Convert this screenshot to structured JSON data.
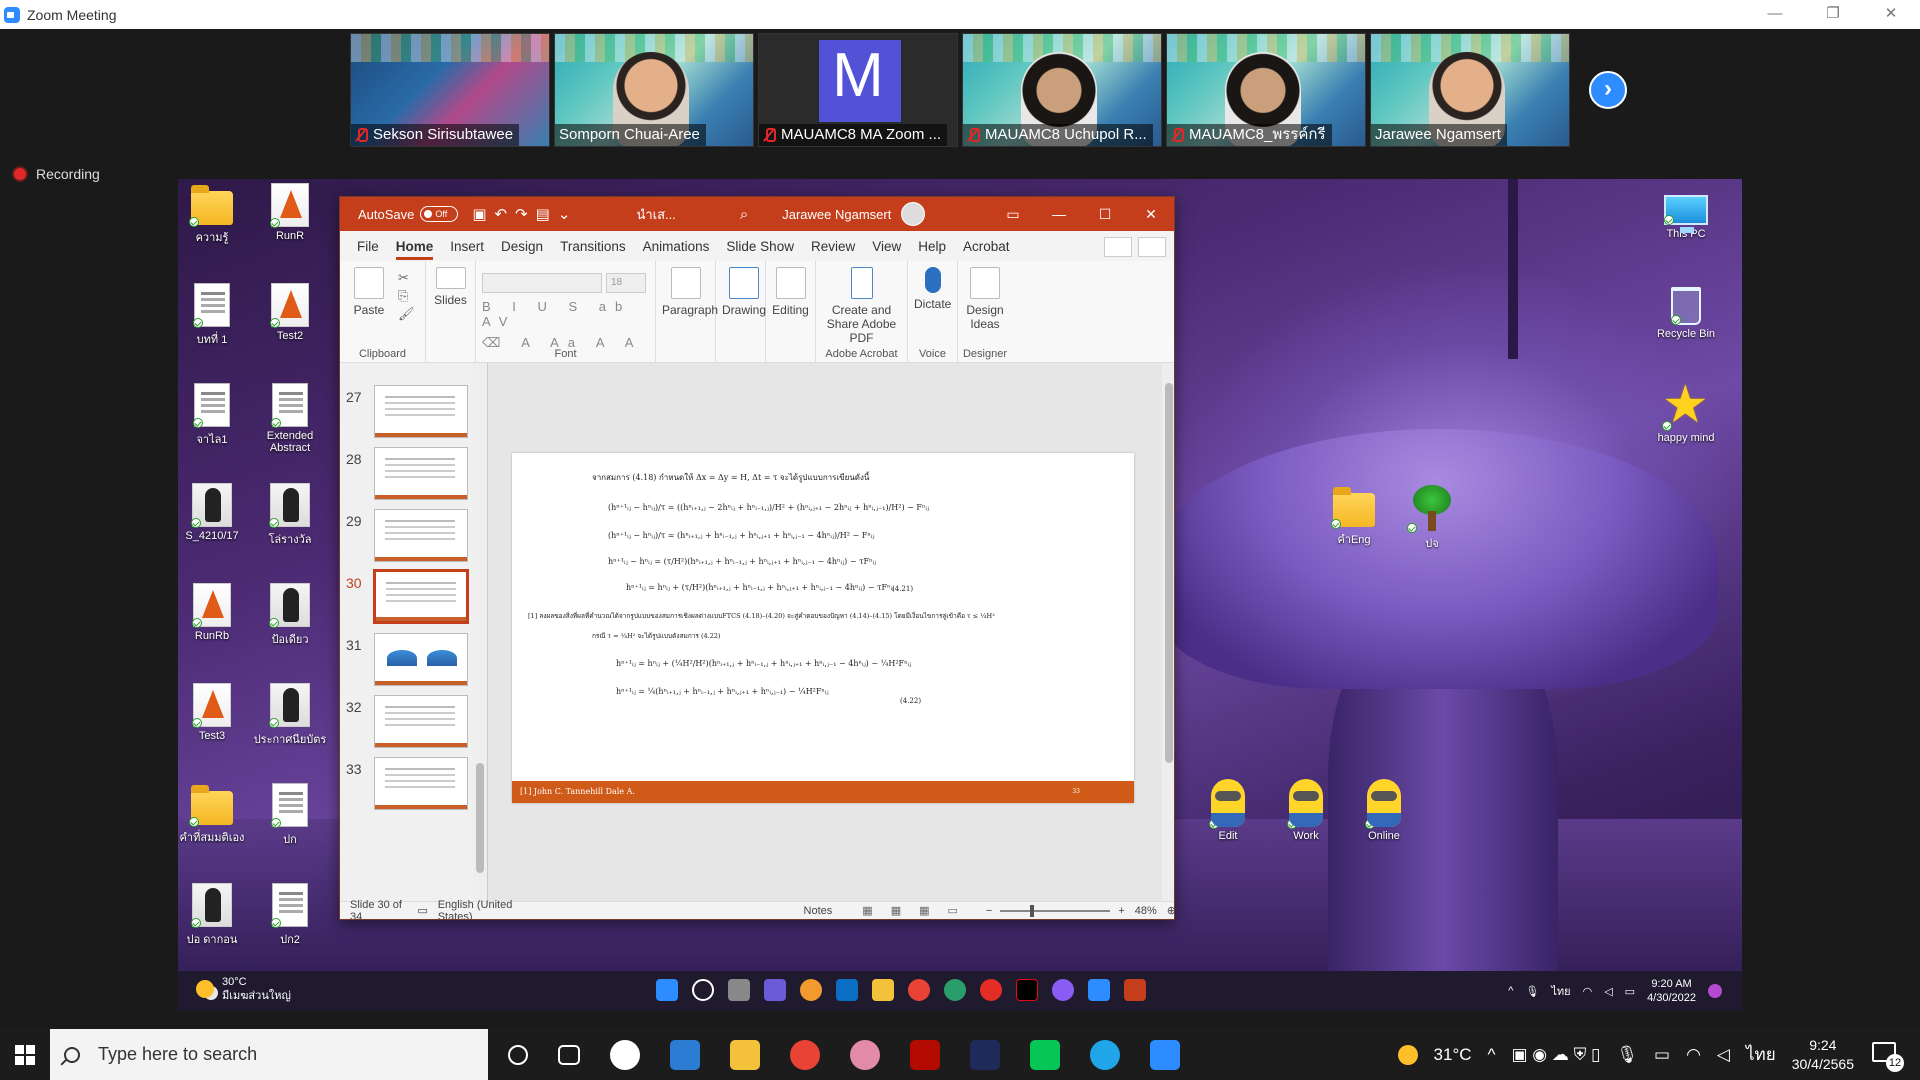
{
  "zoom": {
    "window_title": "Zoom Meeting",
    "window_controls": [
      "—",
      "❐",
      "✕"
    ],
    "participants": [
      {
        "name": "Sekson Sirisubtawee",
        "muted": true,
        "video": "screen"
      },
      {
        "name": "Somporn Chuai-Aree",
        "muted": false,
        "video": "camera"
      },
      {
        "name": "MAUAMC8 MA Zoom ...",
        "muted": true,
        "video": "avatar",
        "initial": "M"
      },
      {
        "name": "MAUAMC8 Uchupol R...",
        "muted": true,
        "video": "camera"
      },
      {
        "name": "MAUAMC8_พรรค์กรี",
        "muted": true,
        "video": "camera"
      },
      {
        "name": "Jarawee Ngamsert",
        "muted": false,
        "video": "camera"
      }
    ],
    "next_page": "›",
    "recording_label": "Recording"
  },
  "desktop": {
    "left_icons": [
      {
        "label": "ความรู้",
        "type": "folder"
      },
      {
        "label": "RunR",
        "type": "rlogo"
      },
      {
        "label": "บทที่ 1",
        "type": "doc"
      },
      {
        "label": "Test2",
        "type": "rlogo"
      },
      {
        "label": "จาไล1",
        "type": "doc"
      },
      {
        "label": "Extended Abstract",
        "type": "doc"
      },
      {
        "label": "S_4210/17",
        "type": "photo"
      },
      {
        "label": "โล่รางวัล",
        "type": "photo"
      },
      {
        "label": "RunRb",
        "type": "rlogo"
      },
      {
        "label": "ป้อเดียว",
        "type": "photo"
      },
      {
        "label": "Test3",
        "type": "rlogo"
      },
      {
        "label": "ประกาศนียบัตร",
        "type": "photo"
      },
      {
        "label": "คำที่สมมติเอง",
        "type": "folder"
      },
      {
        "label": "ปก",
        "type": "doc"
      },
      {
        "label": "ปอ ดากอน",
        "type": "photo"
      },
      {
        "label": "ปก2",
        "type": "doc"
      }
    ],
    "right_icons": [
      {
        "label": "This PC",
        "type": "pc"
      },
      {
        "label": "Recycle Bin",
        "type": "bin"
      },
      {
        "label": "happy mind",
        "type": "star"
      },
      {
        "label": "คำEng",
        "type": "folder"
      },
      {
        "label": "ปจ",
        "type": "tree"
      },
      {
        "label": "Edit",
        "type": "minion"
      },
      {
        "label": "Work",
        "type": "minion"
      },
      {
        "label": "Online",
        "type": "minion"
      }
    ]
  },
  "ppt": {
    "autosave_label": "AutoSave",
    "autosave_state": "Off",
    "doc_name": "นำเส...",
    "user_name": "Jarawee Ngamsert",
    "tabs": [
      "File",
      "Home",
      "Insert",
      "Design",
      "Transitions",
      "Animations",
      "Slide Show",
      "Review",
      "View",
      "Help",
      "Acrobat"
    ],
    "active_tab": "Home",
    "ribbon": {
      "paste": "Paste",
      "clipboard": "Clipboard",
      "slides": "Slides",
      "font_size": "18",
      "font": "Font",
      "paragraph": "Paragraph",
      "drawing": "Drawing",
      "editing": "Editing",
      "create_share": "Create and Share Adobe PDF",
      "adobe_acrobat": "Adobe Acrobat",
      "dictate": "Dictate",
      "voice": "Voice",
      "design_ideas": "Design Ideas",
      "designer": "Designer"
    },
    "thumbnails": [
      "27",
      "28",
      "29",
      "30",
      "31",
      "32",
      "33"
    ],
    "active_slide": "30",
    "slide": {
      "intro": "จากสมการ (4.18) กำหนดให้ Δx = Δy = H, Δt = τ จะได้รูปแบบการเขียนดังนี้",
      "eq1": "(hⁿ⁺¹ᵢⱼ − hⁿᵢⱼ)/τ = ((hⁿᵢ₊₁,ⱼ − 2hⁿᵢⱼ + hⁿᵢ₋₁,ⱼ)/H² + (hⁿᵢ,ⱼ₊₁ − 2hⁿᵢⱼ + hⁿᵢ,ⱼ₋₁)/H²) − Fⁿᵢⱼ",
      "eq2": "(hⁿ⁺¹ᵢⱼ − hⁿᵢⱼ)/τ = (hⁿᵢ₊₁,ⱼ + hⁿᵢ₋₁,ⱼ + hⁿᵢ,ⱼ₊₁ + hⁿᵢ,ⱼ₋₁ − 4hⁿᵢⱼ)/H² − Fⁿᵢⱼ",
      "eq3": "hⁿ⁺¹ᵢⱼ − hⁿᵢⱼ = (τ/H²)(hⁿᵢ₊₁,ⱼ + hⁿᵢ₋₁,ⱼ + hⁿᵢ,ⱼ₊₁ + hⁿᵢ,ⱼ₋₁ − 4hⁿᵢⱼ) − τFⁿᵢⱼ",
      "eq4": "hⁿ⁺¹ᵢⱼ = hⁿᵢⱼ + (τ/H²)(hⁿᵢ₊₁,ⱼ + hⁿᵢ₋₁,ⱼ + hⁿᵢ,ⱼ₊₁ + hⁿᵢ,ⱼ₋₁ − 4hⁿᵢⱼ) − τFⁿᵢⱼ",
      "eq4_num": "(4.21)",
      "note": "[1] ลงผลของสิ่งที่ผลที่คำนวณได้จากรูปแบบของสมการเชิงผลต่างแบบFTCS (4.18)–(4.20) จะสู่คำตอบของปัญหา (4.14)–(4.15) โดยมีเงื่อนไขการลู่เข้าคือ τ ≤ ¼H²",
      "case": "กรณี τ = ¼H² จะได้รูปแบบดังสมการ (4.22)",
      "eq5": "hⁿ⁺¹ᵢⱼ = hⁿᵢⱼ + (¼H²/H²)(hⁿᵢ₊₁,ⱼ + hⁿᵢ₋₁,ⱼ + hⁿᵢ,ⱼ₊₁ + hⁿᵢ,ⱼ₋₁ − 4hⁿᵢⱼ) − ¼H²Fⁿᵢⱼ",
      "eq6": "hⁿ⁺¹ᵢⱼ = ¼(hⁿᵢ₊₁,ⱼ + hⁿᵢ₋₁,ⱼ + hⁿᵢ,ⱼ₊₁ + hⁿᵢ,ⱼ₋₁) − ¼H²Fⁿᵢⱼ",
      "eq6_num": "(4.22)",
      "footer_ref": "[1] John C. Tannehill Dale A.",
      "footer_page": "33"
    },
    "status": {
      "slide_info": "Slide 30 of 34",
      "language": "English (United States)",
      "notes": "Notes",
      "zoom_level": "48%"
    }
  },
  "inner_taskbar": {
    "temp": "30°C",
    "weather": "มีเมฆส่วนใหญ่",
    "time": "9:20 AM",
    "date": "4/30/2022",
    "lang": "ไทย"
  },
  "host_taskbar": {
    "search_placeholder": "Type here to search",
    "temp": "31°C",
    "lang": "ไทย",
    "time": "9:24",
    "date": "30/4/2565",
    "notifications": "12"
  }
}
